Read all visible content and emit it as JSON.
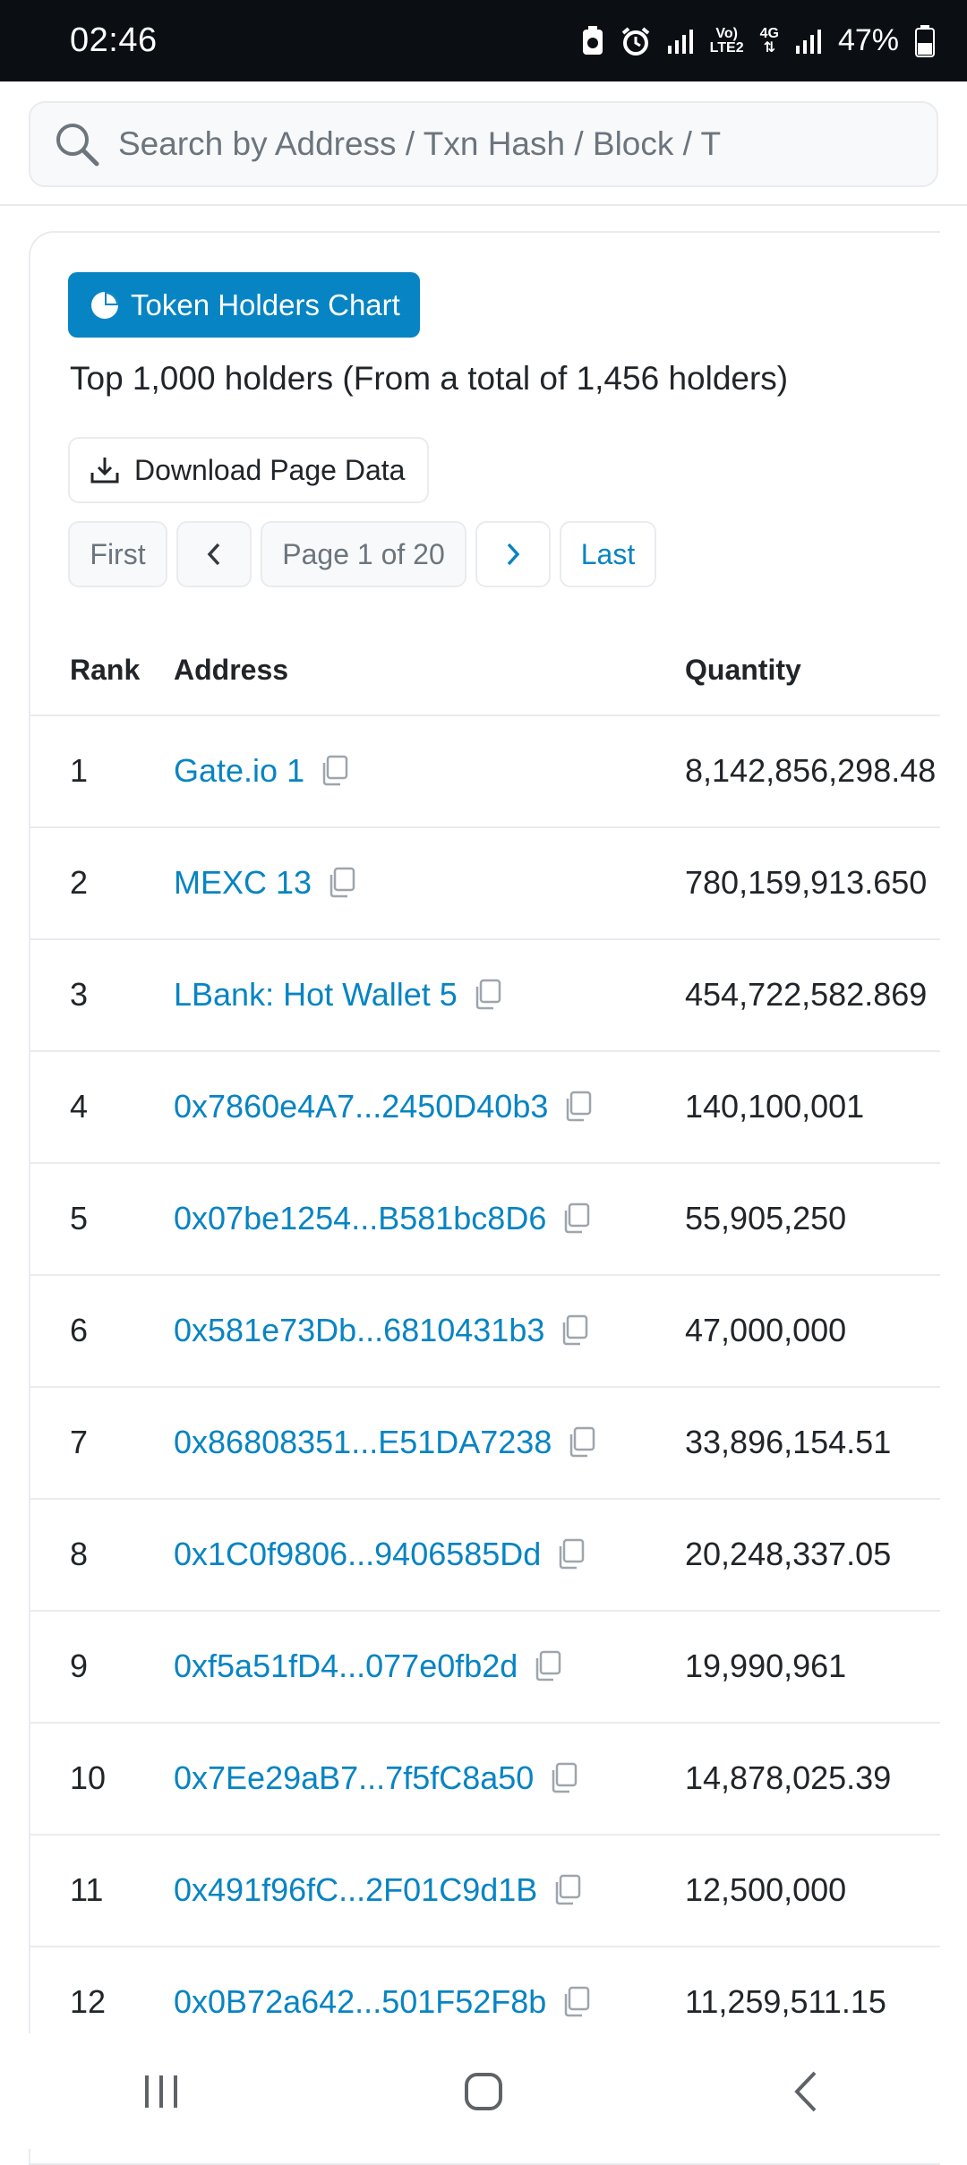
{
  "status_bar": {
    "time": "02:46",
    "net_top": "Vo)",
    "net_bottom": "LTE2",
    "net2": "4G",
    "battery": "47%"
  },
  "search": {
    "placeholder": "Search by Address / Txn Hash / Block / T"
  },
  "card": {
    "chart_button": "Token Holders Chart",
    "holders_summary": "Top 1,000 holders (From a total of 1,456 holders)",
    "download_button": "Download Page Data",
    "pager": {
      "first": "First",
      "page": "Page 1 of 20",
      "last": "Last"
    }
  },
  "table": {
    "headers": {
      "rank": "Rank",
      "address": "Address",
      "quantity": "Quantity"
    },
    "rows": [
      {
        "rank": "1",
        "address": "Gate.io 1",
        "quantity": "8,142,856,298.48"
      },
      {
        "rank": "2",
        "address": "MEXC 13",
        "quantity": "780,159,913.650"
      },
      {
        "rank": "3",
        "address": "LBank: Hot Wallet 5",
        "quantity": "454,722,582.869"
      },
      {
        "rank": "4",
        "address": "0x7860e4A7...2450D40b3",
        "quantity": "140,100,001"
      },
      {
        "rank": "5",
        "address": "0x07be1254...B581bc8D6",
        "quantity": "55,905,250"
      },
      {
        "rank": "6",
        "address": "0x581e73Db...6810431b3",
        "quantity": "47,000,000"
      },
      {
        "rank": "7",
        "address": "0x86808351...E51DA7238",
        "quantity": "33,896,154.51"
      },
      {
        "rank": "8",
        "address": "0x1C0f9806...9406585Dd",
        "quantity": "20,248,337.05"
      },
      {
        "rank": "9",
        "address": "0xf5a51fD4...077e0fb2d",
        "quantity": "19,990,961"
      },
      {
        "rank": "10",
        "address": "0x7Ee29aB7...7f5fC8a50",
        "quantity": "14,878,025.39"
      },
      {
        "rank": "11",
        "address": "0x491f96fC...2F01C9d1B",
        "quantity": "12,500,000"
      },
      {
        "rank": "12",
        "address": "0x0B72a642...501F52F8b",
        "quantity": "11,259,511.15"
      }
    ]
  },
  "colors": {
    "link": "#0784c3",
    "border": "#e9ecef",
    "status_bg": "#0b0f14"
  },
  "icons": [
    "search-icon",
    "pie-chart-icon",
    "download-icon",
    "chevron-left-icon",
    "chevron-right-icon",
    "copy-icon",
    "nav-recents-icon",
    "nav-home-icon",
    "nav-back-icon"
  ]
}
